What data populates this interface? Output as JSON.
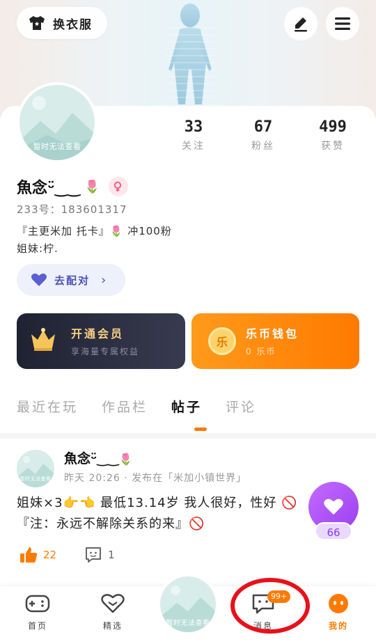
{
  "header": {
    "outfit_label": "换衣服",
    "icons": [
      "shirt-icon",
      "edit-icon",
      "menu-icon"
    ]
  },
  "profile": {
    "avatar_text": "暂时无法查看",
    "username": "魚念ᵕ̈‿‿",
    "id_line": "233号：183601317",
    "bio_line1": "『主更米加 托卡』🌷 冲100粉",
    "bio_line2": "姐妹:柠.",
    "match_label": "去配对"
  },
  "stats": [
    {
      "num": "33",
      "label": "关注"
    },
    {
      "num": "67",
      "label": "粉丝"
    },
    {
      "num": "499",
      "label": "获赞"
    }
  ],
  "cards": {
    "vip_title": "开通会员",
    "vip_sub": "享海量专属权益",
    "coin_title": "乐币钱包",
    "coin_sub": "0 乐币",
    "coin_symbol": "乐"
  },
  "tabs": [
    "最近在玩",
    "作品栏",
    "帖子",
    "评论"
  ],
  "post": {
    "avatar_text": "暂时无法查看",
    "name": "魚念ᵕ̈‿‿",
    "meta": "昨天 20:26 · 发布在「米加小镇世界」",
    "body": "姐妹×3👉👈 最低13.14岁 我人很好，性好 🚫『注：永远不解除关系的来』🚫",
    "likes": "22",
    "comments": "1",
    "float_count": "66"
  },
  "nav": {
    "home": "首页",
    "featured": "精选",
    "center_text": "暂时无法查看",
    "messages": "消息",
    "messages_badge": "99+",
    "mine": "我的"
  },
  "colors": {
    "accent": "#ff7a00",
    "vip_bg": "#262938",
    "purple": "#9b3ff0",
    "highlight_circle": "#e8101a"
  }
}
